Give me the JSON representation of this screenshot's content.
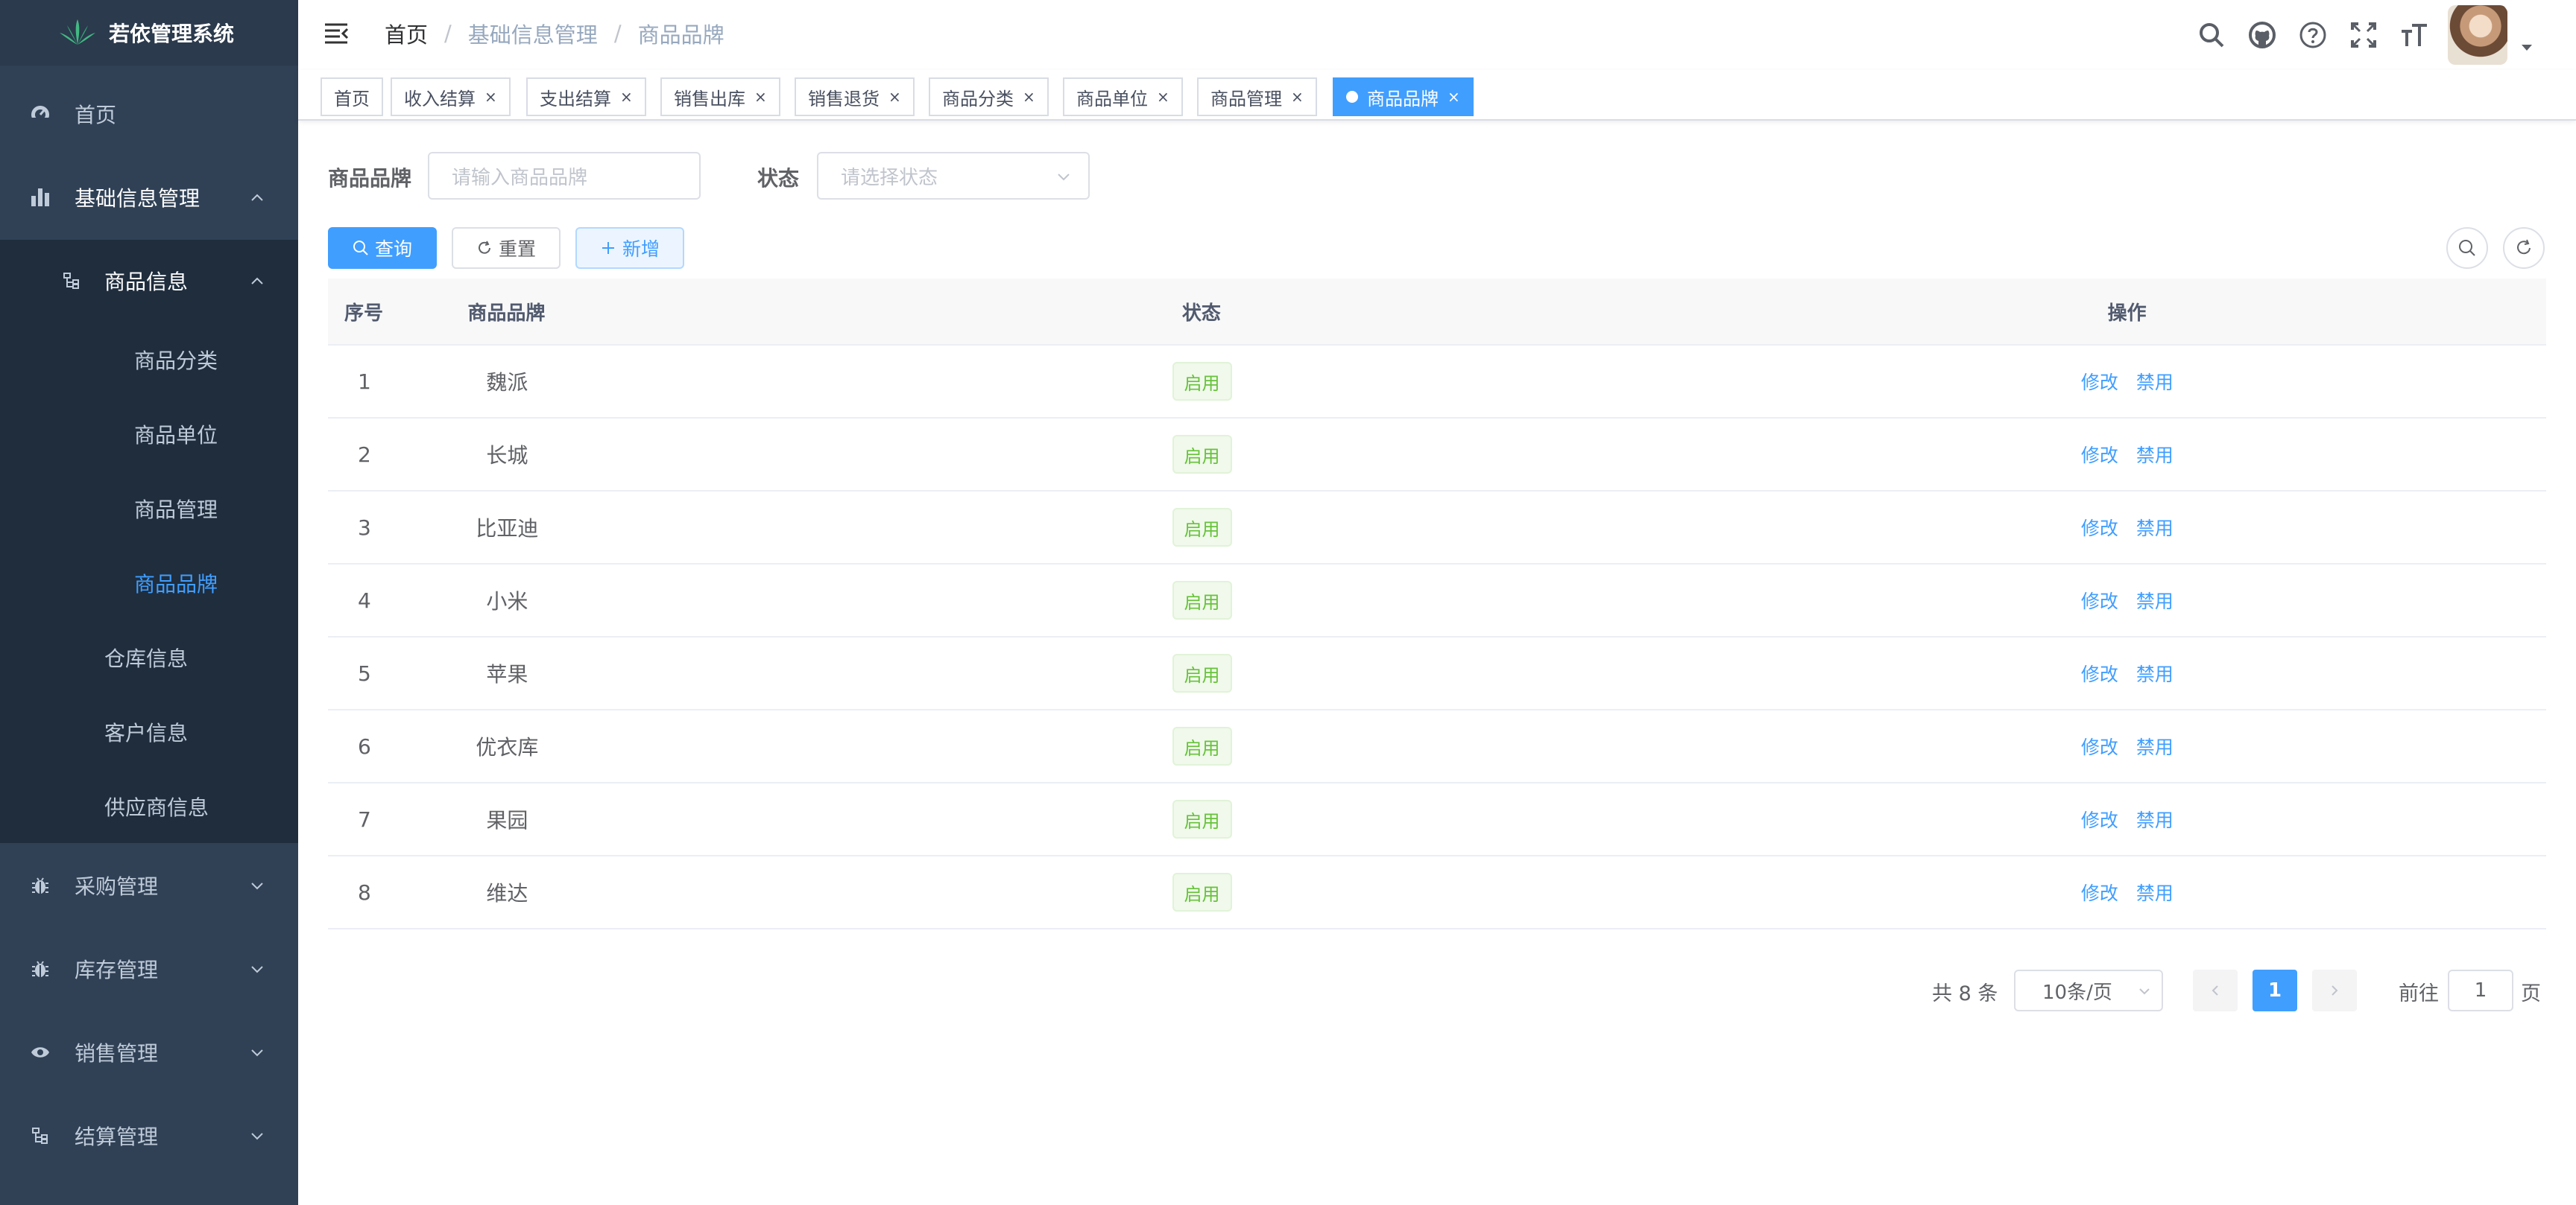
{
  "app": {
    "title": "若依管理系统"
  },
  "sidebar": {
    "items": [
      {
        "label": "首页",
        "icon": "dashboard-icon"
      },
      {
        "label": "基础信息管理",
        "icon": "chart-bar-icon"
      },
      {
        "label": "商品信息",
        "icon": "tree-icon"
      },
      {
        "label": "商品分类"
      },
      {
        "label": "商品单位"
      },
      {
        "label": "商品管理"
      },
      {
        "label": "商品品牌"
      },
      {
        "label": "仓库信息"
      },
      {
        "label": "客户信息"
      },
      {
        "label": "供应商信息"
      },
      {
        "label": "采购管理",
        "icon": "bug-icon"
      },
      {
        "label": "库存管理",
        "icon": "bug-icon"
      },
      {
        "label": "销售管理",
        "icon": "eye-icon"
      },
      {
        "label": "结算管理",
        "icon": "tree-icon"
      }
    ]
  },
  "header": {
    "breadcrumb": [
      "首页",
      "基础信息管理",
      "商品品牌"
    ],
    "separator": "/"
  },
  "tags": [
    {
      "label": "首页"
    },
    {
      "label": "收入结算"
    },
    {
      "label": "支出结算"
    },
    {
      "label": "销售出库"
    },
    {
      "label": "销售退货"
    },
    {
      "label": "商品分类"
    },
    {
      "label": "商品单位"
    },
    {
      "label": "商品管理"
    },
    {
      "label": "商品品牌"
    }
  ],
  "search": {
    "brand_label": "商品品牌",
    "brand_placeholder": "请输入商品品牌",
    "status_label": "状态",
    "status_placeholder": "请选择状态",
    "query_btn": "查询",
    "reset_btn": "重置",
    "add_btn": "新增"
  },
  "table": {
    "headers": [
      "序号",
      "商品品牌",
      "状态",
      "操作"
    ],
    "rows": [
      {
        "no": "1",
        "brand": "魏派",
        "status": "启用"
      },
      {
        "no": "2",
        "brand": "长城",
        "status": "启用"
      },
      {
        "no": "3",
        "brand": "比亚迪",
        "status": "启用"
      },
      {
        "no": "4",
        "brand": "小米",
        "status": "启用"
      },
      {
        "no": "5",
        "brand": "苹果",
        "status": "启用"
      },
      {
        "no": "6",
        "brand": "优衣库",
        "status": "启用"
      },
      {
        "no": "7",
        "brand": "果园",
        "status": "启用"
      },
      {
        "no": "8",
        "brand": "维达",
        "status": "启用"
      }
    ],
    "edit_label": "修改",
    "disable_label": "禁用"
  },
  "pagination": {
    "total": "共 8 条",
    "page_size": "10条/页",
    "current": "1",
    "goto_prefix": "前往",
    "goto_value": "1",
    "goto_suffix": "页"
  },
  "colors": {
    "primary": "#409eff",
    "sidebar_bg": "#304156",
    "success": "#67c23a"
  }
}
